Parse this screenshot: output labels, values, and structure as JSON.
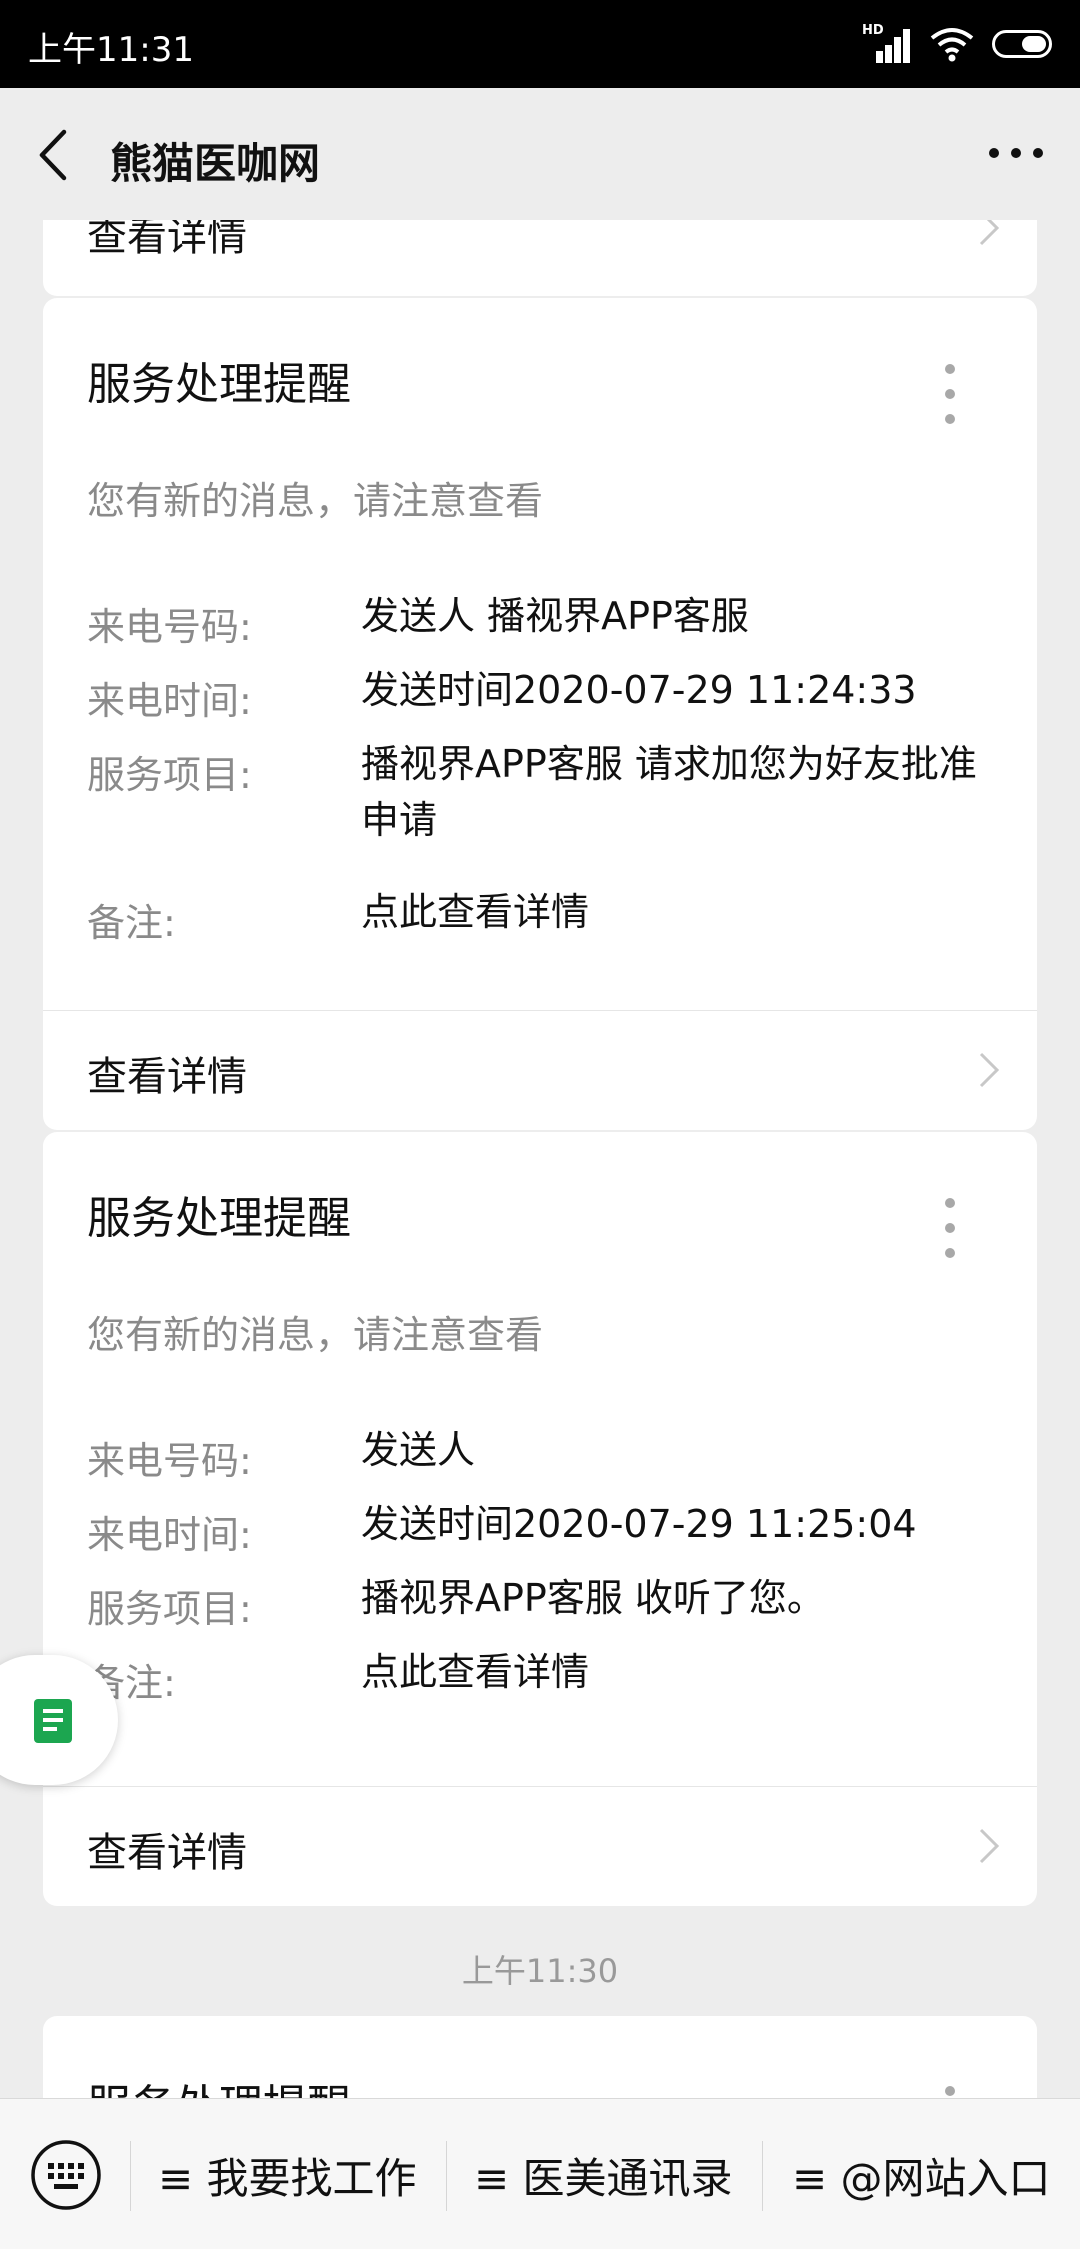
{
  "status_bar": {
    "time": "上午11:31",
    "network_badge": "HD",
    "icons": [
      "signal-icon",
      "wifi-icon",
      "battery-icon"
    ]
  },
  "header": {
    "title": "熊猫医咖网",
    "icons": [
      "back-arrow-icon",
      "more-options-icon"
    ]
  },
  "partial_top_card": {
    "footer": "查看详情"
  },
  "cards": [
    {
      "title": "服务处理提醒",
      "subtitle": "您有新的消息，请注意查看",
      "rows": [
        {
          "label": "来电号码:",
          "value": "发送人 播视界APP客服"
        },
        {
          "label": "来电时间:",
          "value": "发送时间2020-07-29 11:24:33"
        },
        {
          "label": "服务项目:",
          "value": "播视界APP客服 请求加您为好友批准申请"
        },
        {
          "label": "备注:",
          "value": "点此查看详情"
        }
      ],
      "footer": "查看详情"
    },
    {
      "title": "服务处理提醒",
      "subtitle": "您有新的消息，请注意查看",
      "rows": [
        {
          "label": "来电号码:",
          "value": "发送人"
        },
        {
          "label": "来电时间:",
          "value": "发送时间2020-07-29 11:25:04"
        },
        {
          "label": "服务项目:",
          "value": "播视界APP客服 收听了您。"
        },
        {
          "label": "备注:",
          "value": "点此查看详情"
        }
      ],
      "footer": "查看详情"
    }
  ],
  "timestamp": "上午11:30",
  "partial_bottom_card": {
    "title": "服务处理提醒"
  },
  "bottom_menu": {
    "items": [
      "≡ 我要找工作",
      "≡ 医美通讯录",
      "≡ @网站入口"
    ],
    "icons": [
      "keyboard-icon"
    ]
  },
  "floating_button": {
    "icon": "document-icon"
  },
  "colors": {
    "accent_green": "#1ca650",
    "background": "#ededed",
    "card": "#ffffff",
    "secondary_text": "#8a8a8a"
  }
}
